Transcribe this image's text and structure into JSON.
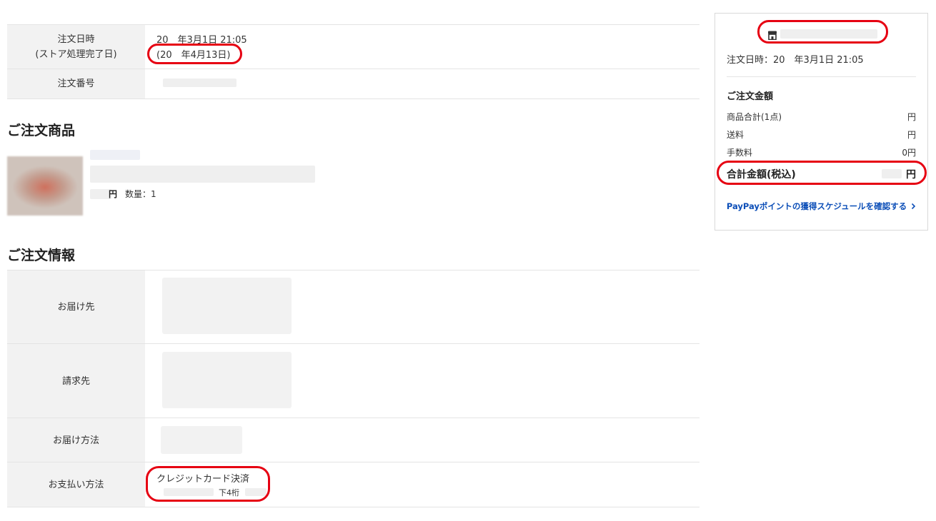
{
  "order_info": {
    "date_label_line1": "注文日時",
    "date_label_line2": "(ストア処理完了日)",
    "date_value": "20　年3月1日 21:05",
    "completed_value": "(20　年4月13日)",
    "number_label": "注文番号"
  },
  "items_section": {
    "title": "ご注文商品",
    "price_unit": "円",
    "quantity_text": "数量：1"
  },
  "info_section": {
    "title": "ご注文情報",
    "rows": [
      {
        "label": "お届け先"
      },
      {
        "label": "請求先"
      },
      {
        "label": "お届け方法"
      },
      {
        "label": "お支払い方法",
        "payment_method": "クレジットカード決済",
        "card_suffix": "下4桁"
      }
    ]
  },
  "side_panel": {
    "order_date": "注文日時：20　年3月1日 21:05",
    "amount_title": "ご注文金額",
    "lines": [
      {
        "label": "商品合計(1点)",
        "value": "円"
      },
      {
        "label": "送料",
        "value": "円"
      },
      {
        "label": "手数料",
        "value": "0円"
      }
    ],
    "total_label": "合計金額(税込)",
    "total_value": "円",
    "points_link": "PayPayポイントの獲得スケジュールを確認する"
  },
  "icons": {
    "store": "store-icon",
    "chevron": "chevron-right-icon"
  },
  "colors": {
    "highlight": "#e60012",
    "link": "#0d4fb8",
    "label_bg": "#f2f2f2"
  }
}
